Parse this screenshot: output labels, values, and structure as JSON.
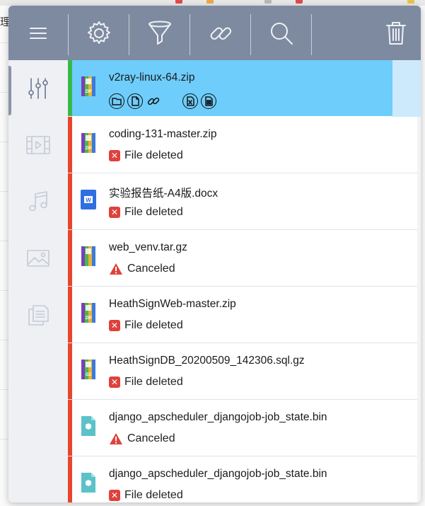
{
  "colors": {
    "toolbar": "#7e8aa0",
    "sidebar": "#eef0f4",
    "selected_row": "#6ecdfb",
    "strip_active": "#38b84a",
    "strip_error": "#e8452b",
    "error_badge": "#e0413c",
    "warning": "#e0413c"
  },
  "background": {
    "side_char": "理"
  },
  "toolbar": {
    "buttons": [
      {
        "icon": "menu-icon"
      },
      {
        "icon": "gear-icon"
      },
      {
        "icon": "filter-icon"
      },
      {
        "icon": "link-icon"
      },
      {
        "icon": "search-icon"
      },
      {
        "icon": "trash-icon"
      }
    ]
  },
  "sidebar": {
    "items": [
      {
        "icon": "sliders-icon",
        "active": true
      },
      {
        "icon": "video-icon",
        "active": false
      },
      {
        "icon": "music-icon",
        "active": false
      },
      {
        "icon": "image-icon",
        "active": false
      },
      {
        "icon": "documents-icon",
        "active": false
      }
    ]
  },
  "downloads": [
    {
      "name": "v2ray-linux-64.zip",
      "file_type": "ZIP",
      "state": "selected",
      "status": ""
    },
    {
      "name": "coding-131-master.zip",
      "file_type": "ZIP",
      "state": "error",
      "status": "File deleted"
    },
    {
      "name": "实验报告纸-A4版.docx",
      "file_type": "W",
      "state": "error",
      "status": "File deleted"
    },
    {
      "name": "web_venv.tar.gz",
      "file_type": "",
      "state": "warning",
      "status": "Canceled"
    },
    {
      "name": "HeathSignWeb-master.zip",
      "file_type": "ZIP",
      "state": "error",
      "status": "File deleted"
    },
    {
      "name": "HeathSignDB_20200509_142306.sql.gz",
      "file_type": "GZ",
      "state": "error",
      "status": "File deleted"
    },
    {
      "name": "django_apscheduler_djangojob-job_state.bin",
      "file_type": "bin",
      "state": "warning",
      "status": "Canceled"
    },
    {
      "name": "django_apscheduler_djangojob-job_state.bin",
      "file_type": "bin",
      "state": "error",
      "status": "File deleted"
    }
  ],
  "selected_actions": [
    "folder-icon",
    "copy-file-icon",
    "link-icon",
    "excel-icon",
    "delete-file-icon"
  ]
}
